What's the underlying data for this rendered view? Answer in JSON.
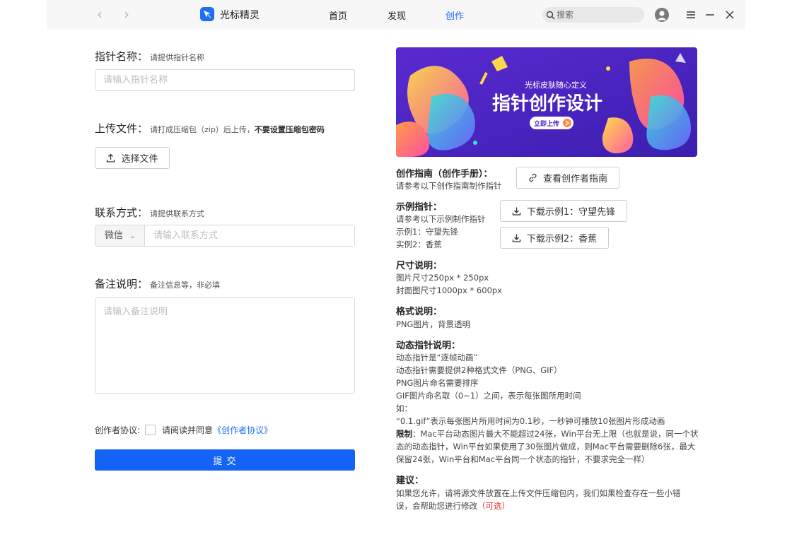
{
  "titlebar": {
    "app_name": "光标精灵",
    "tabs": [
      "首页",
      "发现",
      "创作"
    ],
    "search_placeholder": "搜索",
    "colors": {
      "accent": "#1e6ff5"
    }
  },
  "form": {
    "name_label": "指针名称：",
    "name_hint": "请提供指针名称",
    "name_placeholder": "请输入指针名称",
    "upload_label": "上传文件：",
    "upload_hint": "请打成压缩包（zip）后上传，",
    "upload_hint_bold": "不要设置压缩包密码",
    "upload_button": "选择文件",
    "contact_label": "联系方式：",
    "contact_hint": "请提供联系方式",
    "contact_type": "微信",
    "contact_placeholder": "请输入联系方式",
    "note_label": "备注说明：",
    "note_hint": "备注信息等，非必填",
    "note_placeholder": "请输入备注说明",
    "agreement_label": "创作者协议:",
    "agreement_text": "请阅读并同意",
    "agreement_link": "《创作者协议》",
    "submit": "提 交"
  },
  "banner": {
    "subtitle": "光标皮肤随心定义",
    "title": "指针创作设计",
    "cta": "立即上传"
  },
  "guide": {
    "title": "创作指南（创作手册）：",
    "text": "请参考以下创作指南制作指针",
    "button": "查看创作者指南"
  },
  "examples": {
    "title": "示例指针：",
    "lines": [
      "请参考以下示例制作指针",
      "示例1：守望先锋",
      "实例2：香蕉"
    ],
    "button1": "下载示例1：守望先锋",
    "button2": "下载示例2：香蕉"
  },
  "size": {
    "title": "尺寸说明：",
    "lines": [
      "图片尺寸250px * 250px",
      "封面图尺寸1000px * 600px"
    ]
  },
  "format": {
    "title": "格式说明：",
    "lines": [
      "PNG图片，背景透明"
    ]
  },
  "dynamic": {
    "title": "动态指针说明：",
    "lines": [
      "动态指针是“逐帧动画”",
      "动态指针需要提供2种格式文件（PNG、GIF）",
      "PNG图片命名需要排序",
      "GIF图片命名取（0~1）之间，表示每张图所用时间",
      "如：",
      "“0.1.gif”表示每张图片所用时间为0.1秒，一秒钟可播放10张图片形成动画"
    ],
    "limit_label": "限制",
    "limit_text_1": "：Mac平台动态图片最大不能超过24张，Win平台无上限（也就是说，同一个状",
    "limit_text_2": "态的动态指针，Win平台如果使用了30张图片做成，则Mac平台需要删除6张，最大",
    "limit_text_3": "保留24张，Win平台和Mac平台同一个状态的指针，不要求完全一样）"
  },
  "suggest": {
    "title": "建议：",
    "line1": "如果您允许，请将源文件放置在上传文件压缩包内，我们如果检查存在一些小错",
    "line2": "误，会帮助您进行修改",
    "optional": "（可选）"
  }
}
